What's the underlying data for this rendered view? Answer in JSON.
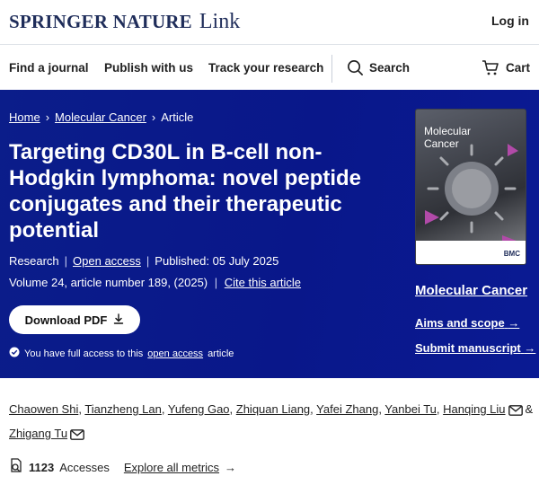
{
  "header": {
    "brand_main": "SPRINGER NATURE",
    "brand_link": "Link",
    "login_label": "Log in"
  },
  "nav": {
    "find_journal": "Find a journal",
    "publish": "Publish with us",
    "track": "Track your research",
    "search": "Search",
    "cart": "Cart"
  },
  "breadcrumb": {
    "home": "Home",
    "journal": "Molecular Cancer",
    "current": "Article"
  },
  "article": {
    "title": "Targeting CD30L in B-cell non-Hodgkin lymphoma: novel peptide conjugates and their therapeutic potential",
    "type": "Research",
    "open_access": "Open access",
    "published": "Published: 05 July 2025",
    "volume": "Volume 24, article number 189, (2025)",
    "cite": "Cite this article",
    "download_label": "Download PDF",
    "access_prefix": "You have full access to this",
    "access_link": "open access",
    "access_suffix": "article"
  },
  "journal": {
    "cover_title_1": "Molecular",
    "cover_title_2": "Cancer",
    "cover_publisher": "BMC",
    "name": "Molecular Cancer",
    "aims": "Aims and scope",
    "submit": "Submit manuscript"
  },
  "authors": [
    "Chaowen Shi",
    "Tianzheng Lan",
    "Yufeng Gao",
    "Zhiquan Liang",
    "Yafei Zhang",
    "Yanbei Tu",
    "Hanqing Liu",
    "Zhigang Tu"
  ],
  "authors_amp": "&",
  "metrics": {
    "count": "1123",
    "label": "Accesses",
    "explore": "Explore all metrics"
  },
  "icons": [
    "search-icon",
    "cart-icon",
    "download-icon",
    "check-circle-icon",
    "mail-icon",
    "accesses-icon",
    "arrow-right-icon"
  ],
  "colors": {
    "hero_bg": "#0b1d8a",
    "brand": "#1f2d5a"
  }
}
